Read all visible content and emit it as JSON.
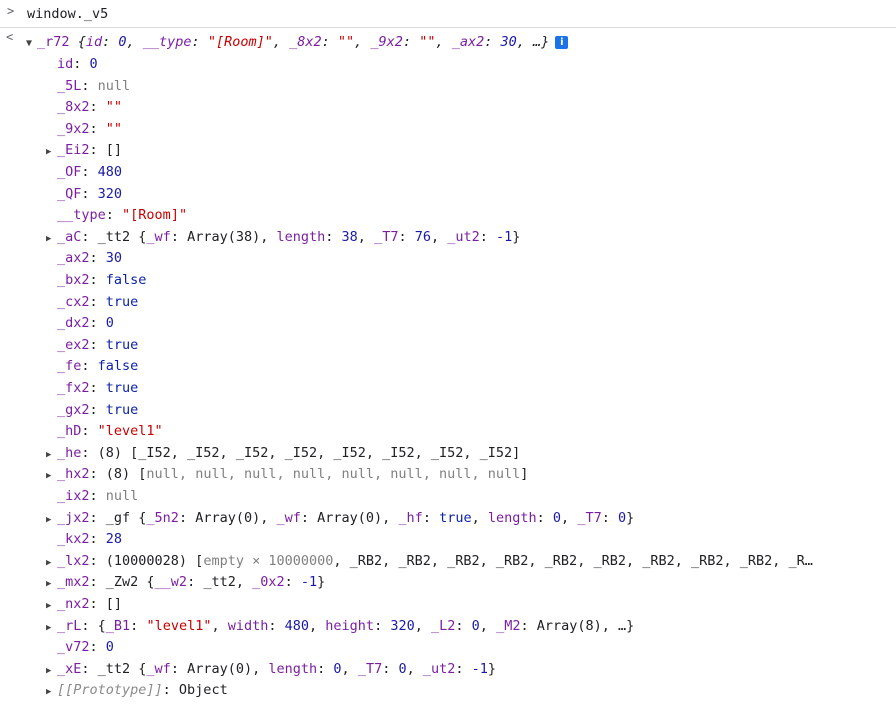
{
  "input": {
    "prompt": ">",
    "command": "window._v5"
  },
  "back_arrow": "<",
  "root": {
    "name": "_r72",
    "preview_parts": [
      {
        "t": "{",
        "c": "ital"
      },
      {
        "t": "id",
        "c": "k ital"
      },
      {
        "t": ": ",
        "c": "ital"
      },
      {
        "t": "0",
        "c": "num ital"
      },
      {
        "t": ", ",
        "c": "ital"
      },
      {
        "t": "__type",
        "c": "k ital"
      },
      {
        "t": ": ",
        "c": "ital"
      },
      {
        "t": "\"[Room]\"",
        "c": "str ital"
      },
      {
        "t": ", ",
        "c": "ital"
      },
      {
        "t": "_8x2",
        "c": "k ital"
      },
      {
        "t": ": ",
        "c": "ital"
      },
      {
        "t": "\"\"",
        "c": "str ital"
      },
      {
        "t": ", ",
        "c": "ital"
      },
      {
        "t": "_9x2",
        "c": "k ital"
      },
      {
        "t": ": ",
        "c": "ital"
      },
      {
        "t": "\"\"",
        "c": "str ital"
      },
      {
        "t": ", ",
        "c": "ital"
      },
      {
        "t": "_ax2",
        "c": "k ital"
      },
      {
        "t": ": ",
        "c": "ital"
      },
      {
        "t": "30",
        "c": "num ital"
      },
      {
        "t": ", …}",
        "c": "ital"
      }
    ],
    "info_icon": "i"
  },
  "properties": [
    {
      "expand": false,
      "parts": [
        {
          "t": "id",
          "c": "k"
        },
        {
          "t": ": ",
          "c": "plain"
        },
        {
          "t": "0",
          "c": "num"
        }
      ]
    },
    {
      "expand": false,
      "parts": [
        {
          "t": "_5L",
          "c": "k"
        },
        {
          "t": ": ",
          "c": "plain"
        },
        {
          "t": "null",
          "c": "nul"
        }
      ]
    },
    {
      "expand": false,
      "parts": [
        {
          "t": "_8x2",
          "c": "k"
        },
        {
          "t": ": ",
          "c": "plain"
        },
        {
          "t": "\"\"",
          "c": "str"
        }
      ]
    },
    {
      "expand": false,
      "parts": [
        {
          "t": "_9x2",
          "c": "k"
        },
        {
          "t": ": ",
          "c": "plain"
        },
        {
          "t": "\"\"",
          "c": "str"
        }
      ]
    },
    {
      "expand": true,
      "parts": [
        {
          "t": "_Ei2",
          "c": "k"
        },
        {
          "t": ": []",
          "c": "plain"
        }
      ]
    },
    {
      "expand": false,
      "parts": [
        {
          "t": "_OF",
          "c": "k"
        },
        {
          "t": ": ",
          "c": "plain"
        },
        {
          "t": "480",
          "c": "num"
        }
      ]
    },
    {
      "expand": false,
      "parts": [
        {
          "t": "_QF",
          "c": "k"
        },
        {
          "t": ": ",
          "c": "plain"
        },
        {
          "t": "320",
          "c": "num"
        }
      ]
    },
    {
      "expand": false,
      "parts": [
        {
          "t": "__type",
          "c": "k"
        },
        {
          "t": ": ",
          "c": "plain"
        },
        {
          "t": "\"[Room]\"",
          "c": "str"
        }
      ]
    },
    {
      "expand": true,
      "parts": [
        {
          "t": "_aC",
          "c": "k"
        },
        {
          "t": ": _tt2 {",
          "c": "plain"
        },
        {
          "t": "_wf",
          "c": "k"
        },
        {
          "t": ": Array(38), ",
          "c": "plain"
        },
        {
          "t": "length",
          "c": "k"
        },
        {
          "t": ": ",
          "c": "plain"
        },
        {
          "t": "38",
          "c": "num"
        },
        {
          "t": ", ",
          "c": "plain"
        },
        {
          "t": "_T7",
          "c": "k"
        },
        {
          "t": ": ",
          "c": "plain"
        },
        {
          "t": "76",
          "c": "num"
        },
        {
          "t": ", ",
          "c": "plain"
        },
        {
          "t": "_ut2",
          "c": "k"
        },
        {
          "t": ": ",
          "c": "plain"
        },
        {
          "t": "-1",
          "c": "num"
        },
        {
          "t": "}",
          "c": "plain"
        }
      ]
    },
    {
      "expand": false,
      "parts": [
        {
          "t": "_ax2",
          "c": "k"
        },
        {
          "t": ": ",
          "c": "plain"
        },
        {
          "t": "30",
          "c": "num"
        }
      ]
    },
    {
      "expand": false,
      "parts": [
        {
          "t": "_bx2",
          "c": "k"
        },
        {
          "t": ": ",
          "c": "plain"
        },
        {
          "t": "false",
          "c": "bool"
        }
      ]
    },
    {
      "expand": false,
      "parts": [
        {
          "t": "_cx2",
          "c": "k"
        },
        {
          "t": ": ",
          "c": "plain"
        },
        {
          "t": "true",
          "c": "bool"
        }
      ]
    },
    {
      "expand": false,
      "parts": [
        {
          "t": "_dx2",
          "c": "k"
        },
        {
          "t": ": ",
          "c": "plain"
        },
        {
          "t": "0",
          "c": "num"
        }
      ]
    },
    {
      "expand": false,
      "parts": [
        {
          "t": "_ex2",
          "c": "k"
        },
        {
          "t": ": ",
          "c": "plain"
        },
        {
          "t": "true",
          "c": "bool"
        }
      ]
    },
    {
      "expand": false,
      "parts": [
        {
          "t": "_fe",
          "c": "k"
        },
        {
          "t": ": ",
          "c": "plain"
        },
        {
          "t": "false",
          "c": "bool"
        }
      ]
    },
    {
      "expand": false,
      "parts": [
        {
          "t": "_fx2",
          "c": "k"
        },
        {
          "t": ": ",
          "c": "plain"
        },
        {
          "t": "true",
          "c": "bool"
        }
      ]
    },
    {
      "expand": false,
      "parts": [
        {
          "t": "_gx2",
          "c": "k"
        },
        {
          "t": ": ",
          "c": "plain"
        },
        {
          "t": "true",
          "c": "bool"
        }
      ]
    },
    {
      "expand": false,
      "parts": [
        {
          "t": "_hD",
          "c": "k"
        },
        {
          "t": ": ",
          "c": "plain"
        },
        {
          "t": "\"level1\"",
          "c": "str"
        }
      ]
    },
    {
      "expand": true,
      "parts": [
        {
          "t": "_he",
          "c": "k"
        },
        {
          "t": ": (8) [_I52, _I52, _I52, _I52, _I52, _I52, _I52, _I52]",
          "c": "plain"
        }
      ]
    },
    {
      "expand": true,
      "parts": [
        {
          "t": "_hx2",
          "c": "k"
        },
        {
          "t": ": (8) [",
          "c": "plain"
        },
        {
          "t": "null, null, null, null, null, null, null, null",
          "c": "nul"
        },
        {
          "t": "]",
          "c": "plain"
        }
      ]
    },
    {
      "expand": false,
      "parts": [
        {
          "t": "_ix2",
          "c": "k"
        },
        {
          "t": ": ",
          "c": "plain"
        },
        {
          "t": "null",
          "c": "nul"
        }
      ]
    },
    {
      "expand": true,
      "parts": [
        {
          "t": "_jx2",
          "c": "k"
        },
        {
          "t": ": _gf {",
          "c": "plain"
        },
        {
          "t": "_5n2",
          "c": "k"
        },
        {
          "t": ": Array(0), ",
          "c": "plain"
        },
        {
          "t": "_wf",
          "c": "k"
        },
        {
          "t": ": Array(0), ",
          "c": "plain"
        },
        {
          "t": "_hf",
          "c": "k"
        },
        {
          "t": ": ",
          "c": "plain"
        },
        {
          "t": "true",
          "c": "bool"
        },
        {
          "t": ", ",
          "c": "plain"
        },
        {
          "t": "length",
          "c": "k"
        },
        {
          "t": ": ",
          "c": "plain"
        },
        {
          "t": "0",
          "c": "num"
        },
        {
          "t": ", ",
          "c": "plain"
        },
        {
          "t": "_T7",
          "c": "k"
        },
        {
          "t": ": ",
          "c": "plain"
        },
        {
          "t": "0",
          "c": "num"
        },
        {
          "t": "}",
          "c": "plain"
        }
      ]
    },
    {
      "expand": false,
      "parts": [
        {
          "t": "_kx2",
          "c": "k"
        },
        {
          "t": ": ",
          "c": "plain"
        },
        {
          "t": "28",
          "c": "num"
        }
      ]
    },
    {
      "expand": true,
      "clip": true,
      "parts": [
        {
          "t": "_lx2",
          "c": "k"
        },
        {
          "t": ": (10000028) [",
          "c": "plain"
        },
        {
          "t": "empty × 10000000",
          "c": "nul"
        },
        {
          "t": ", _RB2, _RB2, _RB2, _RB2, _RB2, _RB2, _RB2, _RB2, _RB2, _R…",
          "c": "plain"
        }
      ]
    },
    {
      "expand": true,
      "parts": [
        {
          "t": "_mx2",
          "c": "k"
        },
        {
          "t": ": _Zw2 {",
          "c": "plain"
        },
        {
          "t": "__w2",
          "c": "k"
        },
        {
          "t": ": _tt2, ",
          "c": "plain"
        },
        {
          "t": "_0x2",
          "c": "k"
        },
        {
          "t": ": ",
          "c": "plain"
        },
        {
          "t": "-1",
          "c": "num"
        },
        {
          "t": "}",
          "c": "plain"
        }
      ]
    },
    {
      "expand": true,
      "parts": [
        {
          "t": "_nx2",
          "c": "k"
        },
        {
          "t": ": []",
          "c": "plain"
        }
      ]
    },
    {
      "expand": true,
      "parts": [
        {
          "t": "_rL",
          "c": "k"
        },
        {
          "t": ": {",
          "c": "plain"
        },
        {
          "t": "_B1",
          "c": "k"
        },
        {
          "t": ": ",
          "c": "plain"
        },
        {
          "t": "\"level1\"",
          "c": "str"
        },
        {
          "t": ", ",
          "c": "plain"
        },
        {
          "t": "width",
          "c": "k"
        },
        {
          "t": ": ",
          "c": "plain"
        },
        {
          "t": "480",
          "c": "num"
        },
        {
          "t": ", ",
          "c": "plain"
        },
        {
          "t": "height",
          "c": "k"
        },
        {
          "t": ": ",
          "c": "plain"
        },
        {
          "t": "320",
          "c": "num"
        },
        {
          "t": ", ",
          "c": "plain"
        },
        {
          "t": "_L2",
          "c": "k"
        },
        {
          "t": ": ",
          "c": "plain"
        },
        {
          "t": "0",
          "c": "num"
        },
        {
          "t": ", ",
          "c": "plain"
        },
        {
          "t": "_M2",
          "c": "k"
        },
        {
          "t": ": Array(8), …}",
          "c": "plain"
        }
      ]
    },
    {
      "expand": false,
      "parts": [
        {
          "t": "_v72",
          "c": "k"
        },
        {
          "t": ": ",
          "c": "plain"
        },
        {
          "t": "0",
          "c": "num"
        }
      ]
    },
    {
      "expand": true,
      "parts": [
        {
          "t": "_xE",
          "c": "k"
        },
        {
          "t": ": _tt2 {",
          "c": "plain"
        },
        {
          "t": "_wf",
          "c": "k"
        },
        {
          "t": ": Array(0), ",
          "c": "plain"
        },
        {
          "t": "length",
          "c": "k"
        },
        {
          "t": ": ",
          "c": "plain"
        },
        {
          "t": "0",
          "c": "num"
        },
        {
          "t": ", ",
          "c": "plain"
        },
        {
          "t": "_T7",
          "c": "k"
        },
        {
          "t": ": ",
          "c": "plain"
        },
        {
          "t": "0",
          "c": "num"
        },
        {
          "t": ", ",
          "c": "plain"
        },
        {
          "t": "_ut2",
          "c": "k"
        },
        {
          "t": ": ",
          "c": "plain"
        },
        {
          "t": "-1",
          "c": "num"
        },
        {
          "t": "}",
          "c": "plain"
        }
      ]
    },
    {
      "expand": true,
      "parts": [
        {
          "t": "[[Prototype]]",
          "c": "k-dim ital"
        },
        {
          "t": ": Object",
          "c": "plain"
        }
      ]
    }
  ]
}
